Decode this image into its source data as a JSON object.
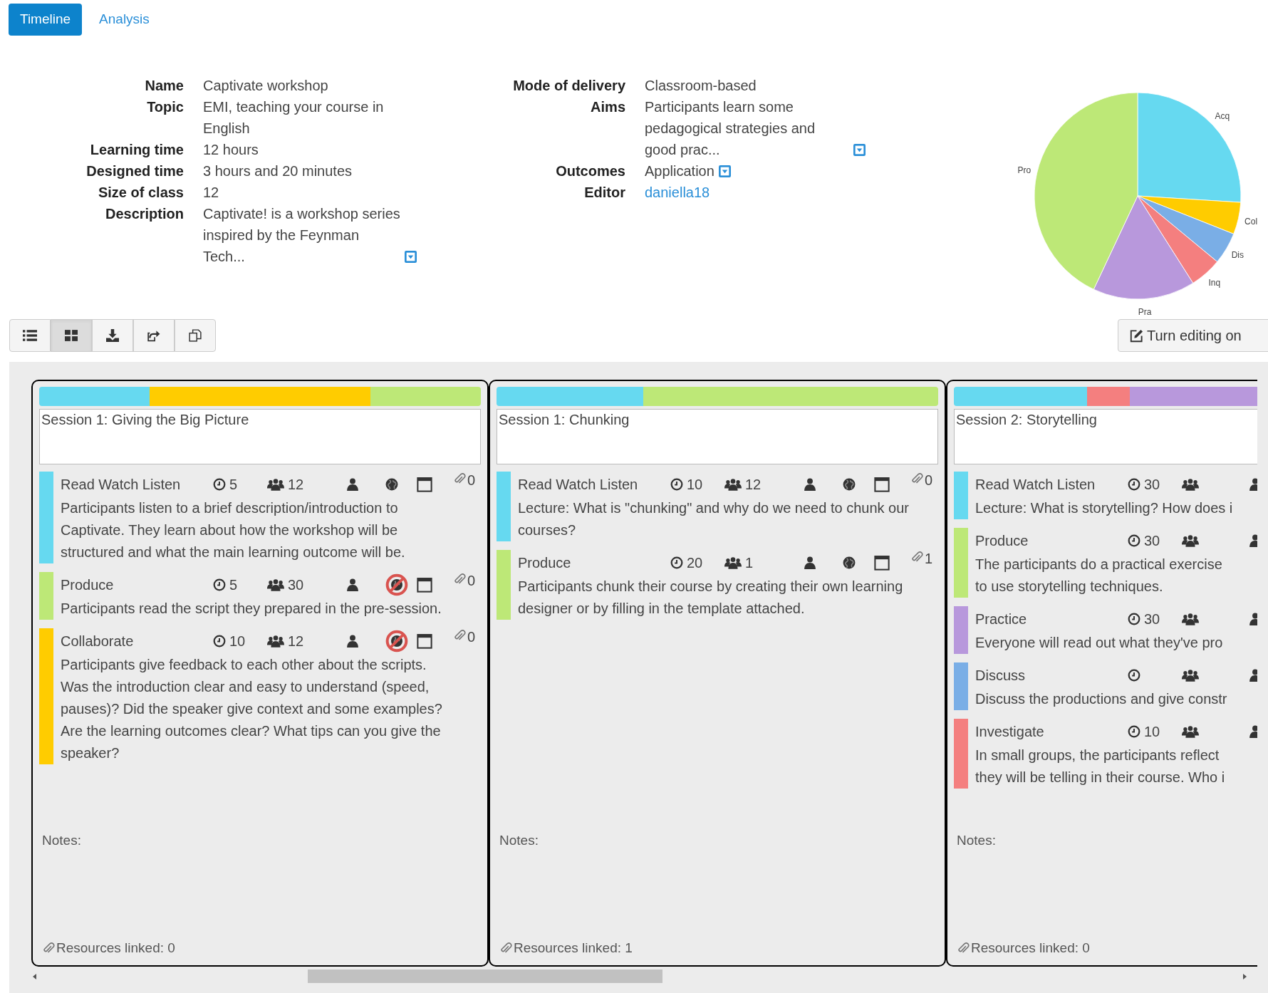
{
  "tabs": [
    {
      "label": "Timeline",
      "selected": true
    },
    {
      "label": "Analysis",
      "selected": false
    }
  ],
  "details_left": [
    {
      "label": "Name",
      "value": "Captivate workshop"
    },
    {
      "label": "Topic",
      "value": "EMI, teaching your course in English"
    },
    {
      "label": "Learning time",
      "value": "12 hours"
    },
    {
      "label": "Designed time",
      "value": "3 hours and 20 minutes"
    },
    {
      "label": "Size of class",
      "value": "12"
    },
    {
      "label": "Description",
      "value": "Captivate! is a workshop series inspired by the Feynman Tech...",
      "expandable": true
    }
  ],
  "details_right": [
    {
      "label": "Mode of delivery",
      "value": "Classroom-based"
    },
    {
      "label": "Aims",
      "value": "Participants learn some pedagogical strategies and good prac...",
      "expandable": true
    },
    {
      "label": "Outcomes",
      "value": "Application",
      "expandable": true
    },
    {
      "label": "Editor",
      "value": "daniella18",
      "kind": "link"
    }
  ],
  "chart_data": {
    "type": "pie",
    "categories": [
      "Acq",
      "Col",
      "Dis",
      "Inq",
      "Pra",
      "Pro"
    ],
    "values": [
      26,
      5,
      5,
      5,
      16,
      43
    ],
    "colors": [
      "#66d9f0",
      "#ffcc00",
      "#7aaee6",
      "#f47f7f",
      "#b898dc",
      "#bde877"
    ]
  },
  "toolbar": [
    {
      "kind": "list",
      "selected": false
    },
    {
      "kind": "grid",
      "selected": true
    },
    {
      "kind": "download",
      "selected": false
    },
    {
      "kind": "share",
      "selected": false
    },
    {
      "kind": "copy",
      "selected": false
    }
  ],
  "edit_button": {
    "label": "Turn editing on"
  },
  "sessions": [
    {
      "title": "Session 1: Giving the Big Picture",
      "segments": [
        {
          "color": "#66d9f0"
        },
        {
          "color": "#ffcc00"
        },
        {
          "color": "#bde877"
        }
      ],
      "activities": [
        {
          "type": "Read Watch Listen",
          "color": "#66d9f0",
          "duration": "5",
          "group_size": "12",
          "online": true,
          "calendar": true,
          "attachments": "0",
          "lines": [
            "Participants listen to a brief description/introduction to Captivate. They learn about how the workshop will be structured and what the main learning outcome will be."
          ]
        },
        {
          "type": "Produce",
          "color": "#bde877",
          "duration": "5",
          "group_size": "30",
          "online": false,
          "calendar": true,
          "attachments": "0",
          "lines": [
            "Participants read the script they prepared in the pre-session."
          ]
        },
        {
          "type": "Collaborate",
          "color": "#ffcc00",
          "duration": "10",
          "group_size": "12",
          "online": false,
          "calendar": true,
          "attachments": "0",
          "lines": [
            "Participants give feedback to each other about the scripts. Was the introduction clear and easy to understand (speed, pauses)? Did the speaker give context and some examples? Are the learning outcomes clear? What tips can you give the speaker?"
          ]
        }
      ],
      "notes_label": "Notes:",
      "resources": "Resources linked: 0"
    },
    {
      "title": "Session 1: Chunking",
      "segments": [
        {
          "color": "#66d9f0"
        },
        {
          "color": "#bde877"
        }
      ],
      "activities": [
        {
          "type": "Read Watch Listen",
          "color": "#66d9f0",
          "duration": "10",
          "group_size": "12",
          "online": true,
          "calendar": true,
          "attachments": "0",
          "lines": [
            "Lecture: What is \"chunking\" and why do we need to chunk our courses?"
          ]
        },
        {
          "type": "Produce",
          "color": "#bde877",
          "duration": "20",
          "group_size": "1",
          "online": true,
          "calendar": true,
          "attachments": "1",
          "lines": [
            "Participants chunk their course by creating their own learning designer or by filling in the template attached."
          ]
        }
      ],
      "notes_label": "Notes:",
      "resources": "Resources linked: 1"
    },
    {
      "title": "Session 2: Storytelling",
      "clipped": true,
      "segments": [
        {
          "color": "#66d9f0"
        },
        {
          "color": "#f47f7f"
        },
        {
          "color": "#b898dc"
        }
      ],
      "activities": [
        {
          "type": "Read Watch Listen",
          "color": "#66d9f0",
          "duration": "30",
          "lines": [
            "Lecture: What is storytelling? How does i"
          ]
        },
        {
          "type": "Produce",
          "color": "#bde877",
          "duration": "30",
          "lines": [
            "The participants do a practical exercise",
            "to use storytelling techniques."
          ]
        },
        {
          "type": "Practice",
          "color": "#b898dc",
          "duration": "30",
          "lines": [
            "Everyone will read out what they've pro"
          ]
        },
        {
          "type": "Discuss",
          "color": "#7aaee6",
          "lines": [
            "Discuss the productions and give constr"
          ]
        },
        {
          "type": "Investigate",
          "color": "#f47f7f",
          "duration": "10",
          "lines": [
            "In small groups, the participants reflect",
            "they will be telling in their course. Who i"
          ]
        }
      ],
      "notes_label": "Notes:",
      "resources": "Resources linked: 0"
    }
  ]
}
